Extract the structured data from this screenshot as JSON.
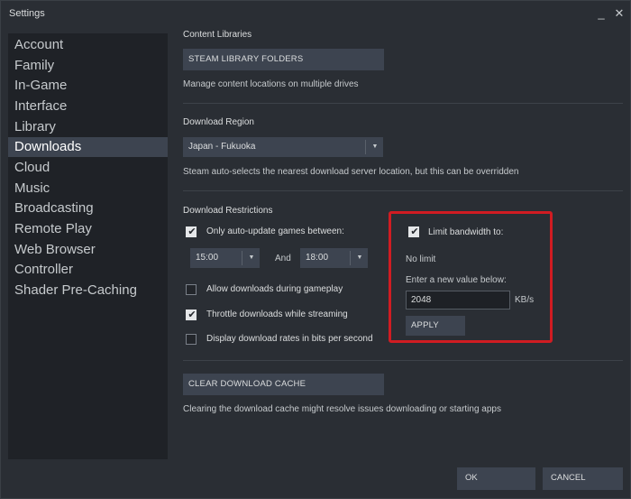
{
  "window": {
    "title": "Settings",
    "minimize_glyph": "_",
    "close_glyph": "✕"
  },
  "sidebar": {
    "items": [
      {
        "label": "Account",
        "active": false
      },
      {
        "label": "Family",
        "active": false
      },
      {
        "label": "In-Game",
        "active": false
      },
      {
        "label": "Interface",
        "active": false
      },
      {
        "label": "Library",
        "active": false
      },
      {
        "label": "Downloads",
        "active": true
      },
      {
        "label": "Cloud",
        "active": false
      },
      {
        "label": "Music",
        "active": false
      },
      {
        "label": "Broadcasting",
        "active": false
      },
      {
        "label": "Remote Play",
        "active": false
      },
      {
        "label": "Web Browser",
        "active": false
      },
      {
        "label": "Controller",
        "active": false
      },
      {
        "label": "Shader Pre-Caching",
        "active": false
      }
    ]
  },
  "content_libraries": {
    "title": "Content Libraries",
    "button_label": "STEAM LIBRARY FOLDERS",
    "description": "Manage content locations on multiple drives"
  },
  "download_region": {
    "title": "Download Region",
    "selected": "Japan - Fukuoka",
    "description": "Steam auto-selects the nearest download server location, but this can be overridden"
  },
  "download_restrictions": {
    "title": "Download Restrictions",
    "auto_update": {
      "label": "Only auto-update games between:",
      "checked": true
    },
    "start_time": "15:00",
    "and_label": "And",
    "end_time": "18:00",
    "allow_during_gameplay": {
      "label": "Allow downloads during gameplay",
      "checked": false
    },
    "throttle_streaming": {
      "label": "Throttle downloads while streaming",
      "checked": true
    },
    "bits_per_second": {
      "label": "Display download rates in bits per second",
      "checked": false
    }
  },
  "bandwidth": {
    "limit": {
      "label": "Limit bandwidth to:",
      "checked": true
    },
    "current_status": "No limit",
    "prompt": "Enter a new value below:",
    "value": "2048",
    "unit": "KB/s",
    "apply_label": "APPLY"
  },
  "download_cache": {
    "button_label": "CLEAR DOWNLOAD CACHE",
    "description": "Clearing the download cache might resolve issues downloading or starting apps"
  },
  "footer": {
    "ok_label": "OK",
    "cancel_label": "CANCEL"
  },
  "colors": {
    "highlight_border": "#d01c22",
    "active_nav_bg": "#3d4450",
    "window_bg": "#2a2e34"
  },
  "icons": {
    "dropdown": "chevron-down-icon",
    "checkmark": "checkmark-icon"
  }
}
